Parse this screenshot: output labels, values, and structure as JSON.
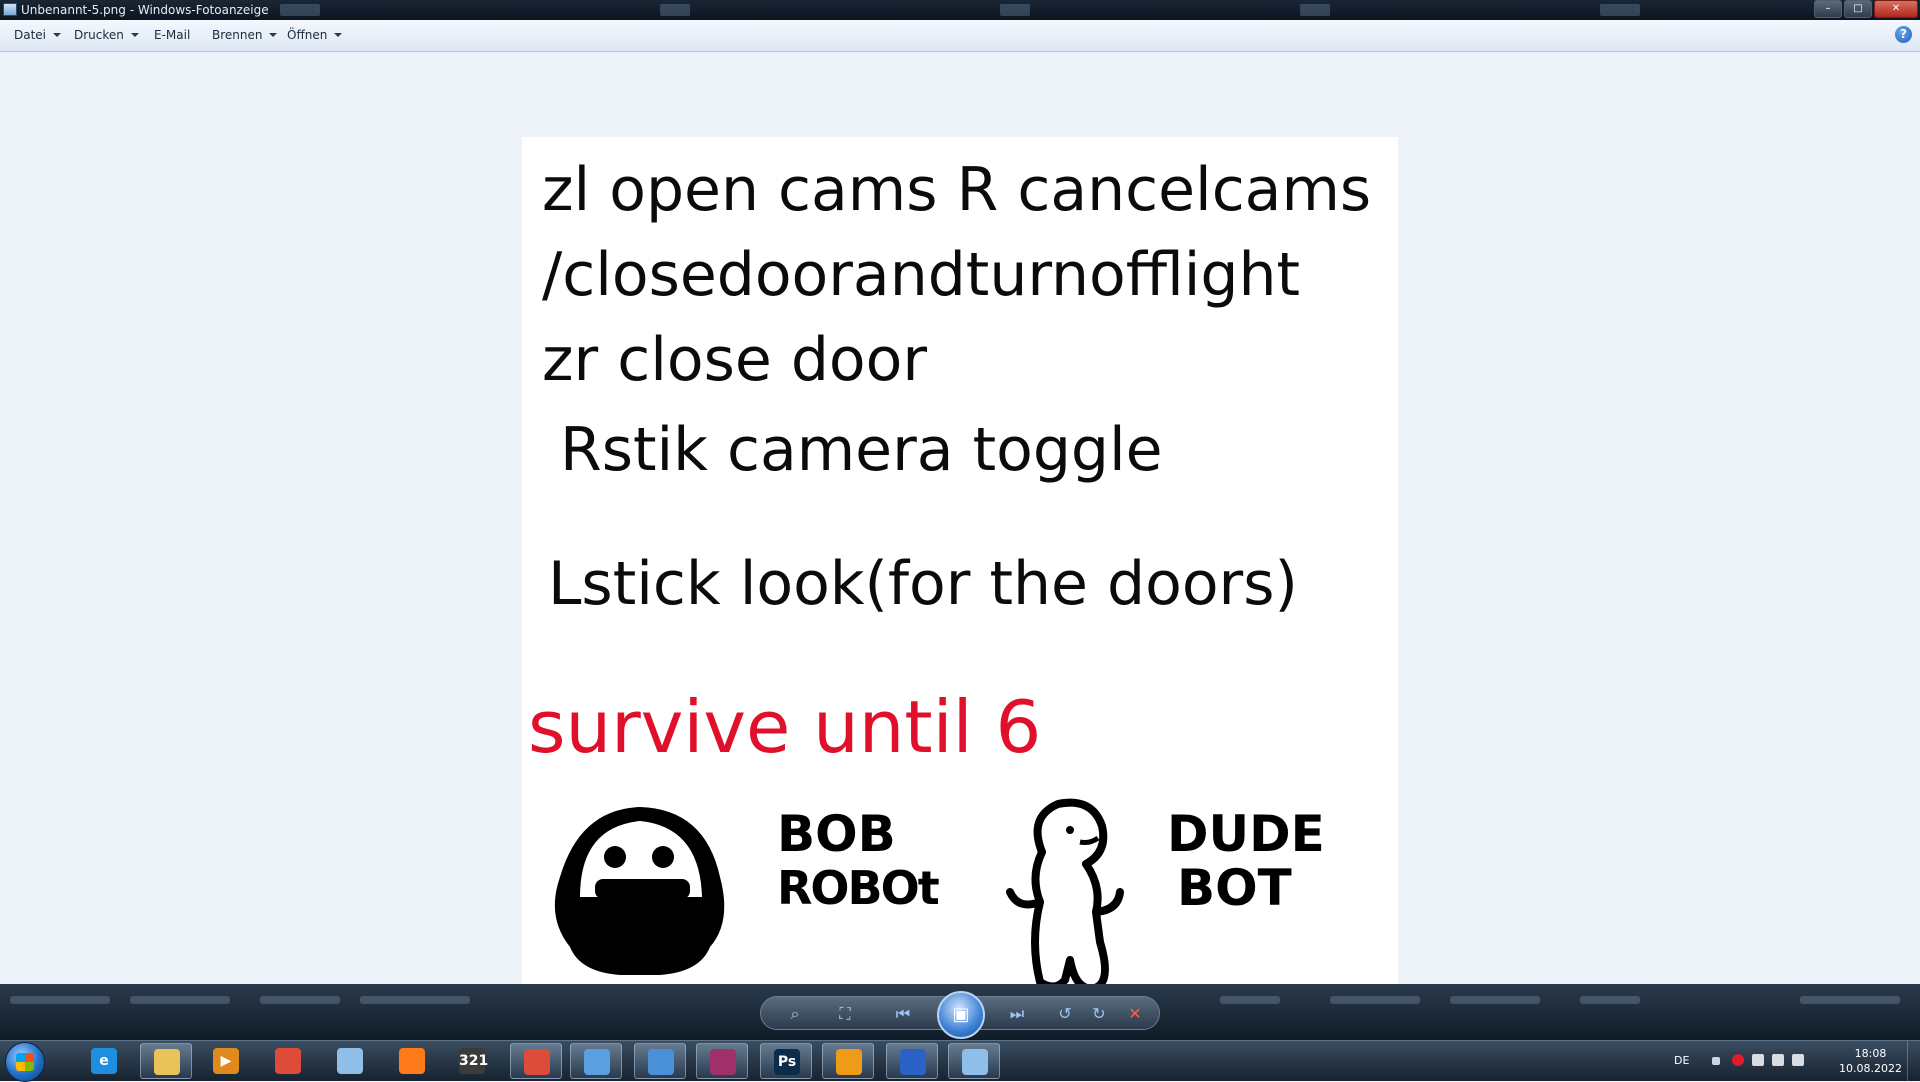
{
  "window": {
    "title": "Unbenannt-5.png - Windows-Fotoanzeige",
    "controls": {
      "minimize": "–",
      "maximize": "□",
      "close": "✕"
    }
  },
  "menu": {
    "items": [
      {
        "label": "Datei",
        "has_dropdown": true
      },
      {
        "label": "Drucken",
        "has_dropdown": true
      },
      {
        "label": "E-Mail",
        "has_dropdown": false
      },
      {
        "label": "Brennen",
        "has_dropdown": true
      },
      {
        "label": "Öffnen",
        "has_dropdown": true
      }
    ],
    "help_icon": "?"
  },
  "image": {
    "lines": [
      "zl open cams R cancelcams",
      "/closedoorandturnofflight",
      "zr close door",
      "Rstik camera toggle",
      "Lstick look(for the doors)"
    ],
    "goal": "survive until 6",
    "goal_color": "#e0102a",
    "characters": [
      {
        "name_line1": "BOB",
        "name_line2": "ROBOt",
        "icon": "bob-robot-drawing"
      },
      {
        "name_line1": "DUDE",
        "name_line2": "BOT",
        "icon": "dude-bot-drawing"
      }
    ]
  },
  "viewer_controls": {
    "buttons": [
      "zoom",
      "fit-to-window",
      "previous",
      "slideshow",
      "next",
      "rotate-left",
      "rotate-right",
      "delete"
    ],
    "symbols": {
      "zoom": "⌕",
      "fit": "⛶",
      "prev": "⏮",
      "slideshow": "▣",
      "next": "⏭",
      "rotate_left": "↺",
      "rotate_right": "↻",
      "delete": "✕"
    }
  },
  "taskbar": {
    "tray": {
      "language": "DE",
      "time": "18:08",
      "date": "10.08.2022"
    },
    "apps": [
      {
        "icon": "internet-explorer-icon",
        "glyph": "e",
        "color": "#1e8fe0",
        "active": false
      },
      {
        "icon": "file-explorer-icon",
        "glyph": "",
        "color": "#e8c35a",
        "active": true
      },
      {
        "icon": "media-player-icon",
        "glyph": "▶",
        "color": "#e08a1e",
        "active": false
      },
      {
        "icon": "chrome-icon",
        "glyph": "",
        "color": "#dd4b39",
        "active": false
      },
      {
        "icon": "paint-icon",
        "glyph": "",
        "color": "#8fbfe8",
        "active": false
      },
      {
        "icon": "firefox-icon",
        "glyph": "",
        "color": "#ff7a1a",
        "active": false
      },
      {
        "icon": "video-editor-icon",
        "glyph": "321",
        "color": "#3b3b3b",
        "active": false
      },
      {
        "icon": "chrome-window-icon",
        "glyph": "",
        "color": "#dd4b39",
        "active": true
      },
      {
        "icon": "photo-viewer-icon",
        "glyph": "",
        "color": "#5aa0e0",
        "active": true
      },
      {
        "icon": "remote-desktop-icon",
        "glyph": "",
        "color": "#4a90d9",
        "active": true
      },
      {
        "icon": "winrar-icon",
        "glyph": "",
        "color": "#a0306a",
        "active": true
      },
      {
        "icon": "photoshop-icon",
        "glyph": "Ps",
        "color": "#0b2c4a",
        "active": true
      },
      {
        "icon": "fl-studio-icon",
        "glyph": "",
        "color": "#f09a1a",
        "active": true
      },
      {
        "icon": "sonic-game-icon",
        "glyph": "",
        "color": "#2a62c8",
        "active": true
      },
      {
        "icon": "paint-window-icon",
        "glyph": "",
        "color": "#8fbfe8",
        "active": true
      }
    ]
  }
}
